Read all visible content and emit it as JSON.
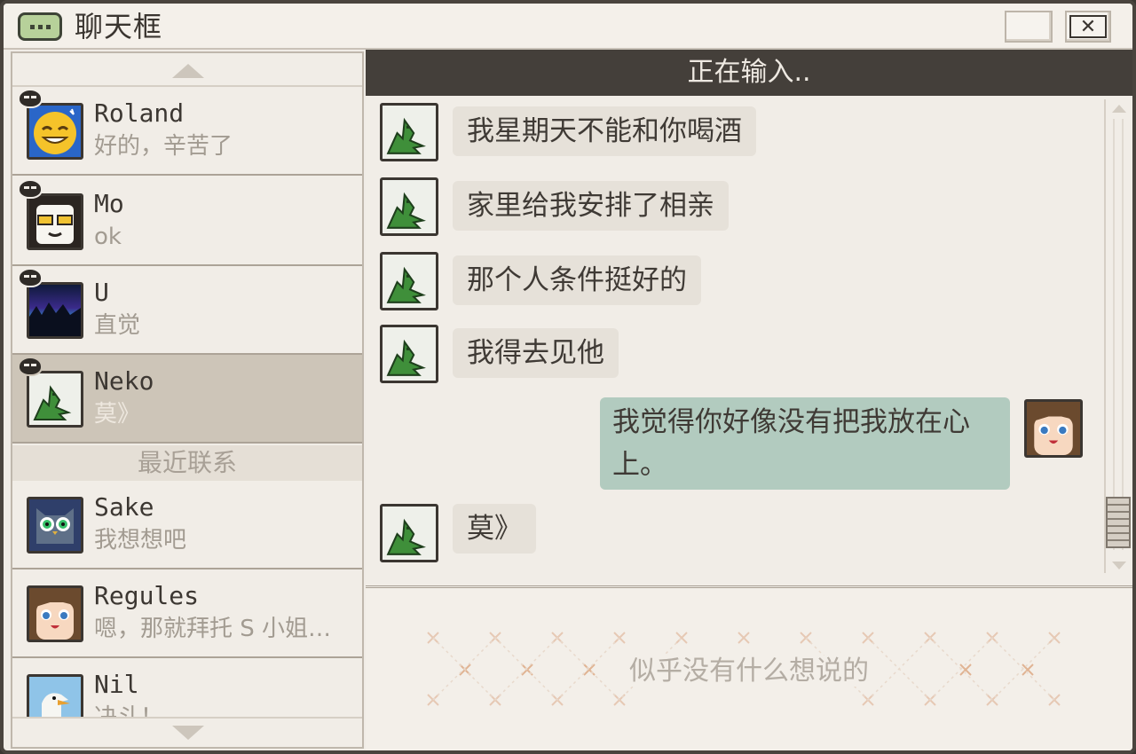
{
  "window": {
    "title": "聊天框",
    "icons": [
      "chat-bubble-icon",
      "minimize-icon",
      "close-icon"
    ],
    "close_glyph": "✕"
  },
  "sidebar": {
    "contacts": [
      {
        "name": "Roland",
        "preview": "好的，辛苦了",
        "avatar": "smiley-face-avatar",
        "online": true
      },
      {
        "name": "Mo",
        "preview": "ok",
        "avatar": "cool-glasses-avatar",
        "online": true
      },
      {
        "name": "U",
        "preview": "直觉",
        "avatar": "aurora-avatar",
        "online": true
      },
      {
        "name": "Neko",
        "preview": "莫》",
        "avatar": "green-dino-avatar",
        "online": true,
        "active": true
      }
    ],
    "recent_label": "最近联系",
    "recent": [
      {
        "name": "Sake",
        "preview": "我想想吧",
        "avatar": "owl-avatar"
      },
      {
        "name": "Regules",
        "preview": "嗯，那就拜托 S 小姐…",
        "avatar": "girl-avatar"
      },
      {
        "name": "Nil",
        "preview": "决斗！",
        "avatar": "seagull-avatar"
      }
    ]
  },
  "chat": {
    "status": "正在输入..",
    "messages": [
      {
        "from": "Neko",
        "text": "我星期天不能和你喝酒"
      },
      {
        "from": "Neko",
        "text": "家里给我安排了相亲"
      },
      {
        "from": "Neko",
        "text": "那个人条件挺好的"
      },
      {
        "from": "Neko",
        "text": "我得去见他"
      },
      {
        "from": "me",
        "text": "我觉得你好像没有把我放在心上。"
      },
      {
        "from": "Neko",
        "text": "莫》"
      }
    ]
  },
  "input": {
    "placeholder": "似乎没有什么想说的"
  },
  "colors": {
    "frame": "#4a443e",
    "header_bg": "#443f3a",
    "active_contact": "#cdc5b8",
    "bubble_other": "#e6e1d9",
    "bubble_mine": "#b2cbbf",
    "dino_green": "#3f8f3a"
  }
}
